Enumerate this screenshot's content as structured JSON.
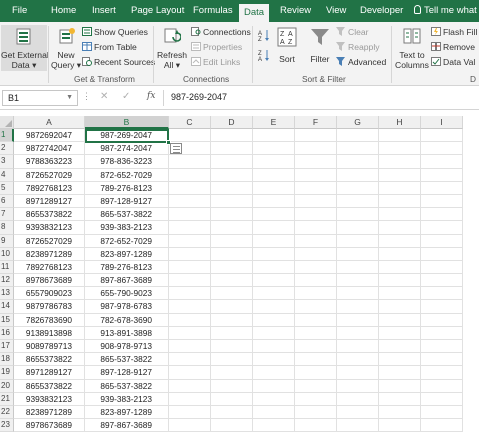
{
  "tabs": {
    "file": "File",
    "home": "Home",
    "insert": "Insert",
    "page_layout": "Page Layout",
    "formulas": "Formulas",
    "data": "Data",
    "review": "Review",
    "view": "View",
    "developer": "Developer",
    "tell_me": "Tell me what"
  },
  "ribbon": {
    "get_external_data": [
      "Get External",
      "Data"
    ],
    "new_query": [
      "New",
      "Query"
    ],
    "show_queries": "Show Queries",
    "from_table": "From Table",
    "recent_sources": "Recent Sources",
    "refresh_all": [
      "Refresh",
      "All"
    ],
    "connections": "Connections",
    "properties": "Properties",
    "edit_links": "Edit Links",
    "sort": "Sort",
    "filter": "Filter",
    "clear": "Clear",
    "reapply": "Reapply",
    "advanced": "Advanced",
    "text_to_columns": [
      "Text to",
      "Columns"
    ],
    "flash_fill": "Flash Fill",
    "remove_duplicates": "Remove",
    "data_validation": "Data Val",
    "groups": {
      "get_transform": "Get & Transform",
      "connections": "Connections",
      "sort_filter": "Sort & Filter",
      "data_tools_partial": "D"
    },
    "accent_color": "#217346"
  },
  "formula_bar": {
    "name_box": "B1",
    "fx": "fx",
    "value": "987-269-2047"
  },
  "grid": {
    "columns": [
      "A",
      "B",
      "C",
      "D",
      "E",
      "F",
      "G",
      "H",
      "I"
    ],
    "selected_cell": "B1",
    "rows": [
      [
        "1",
        "9872692047",
        "987-269-2047"
      ],
      [
        "2",
        "9872742047",
        "987-274-2047"
      ],
      [
        "3",
        "9788363223",
        "978-836-3223"
      ],
      [
        "4",
        "8726527029",
        "872-652-7029"
      ],
      [
        "5",
        "7892768123",
        "789-276-8123"
      ],
      [
        "6",
        "8971289127",
        "897-128-9127"
      ],
      [
        "7",
        "8655373822",
        "865-537-3822"
      ],
      [
        "8",
        "9393832123",
        "939-383-2123"
      ],
      [
        "9",
        "8726527029",
        "872-652-7029"
      ],
      [
        "10",
        "8238971289",
        "823-897-1289"
      ],
      [
        "11",
        "7892768123",
        "789-276-8123"
      ],
      [
        "12",
        "8978673689",
        "897-867-3689"
      ],
      [
        "13",
        "6557909023",
        "655-790-9023"
      ],
      [
        "14",
        "9879786783",
        "987-978-6783"
      ],
      [
        "15",
        "7826783690",
        "782-678-3690"
      ],
      [
        "16",
        "9138913898",
        "913-891-3898"
      ],
      [
        "17",
        "9089789713",
        "908-978-9713"
      ],
      [
        "18",
        "8655373822",
        "865-537-3822"
      ],
      [
        "19",
        "8971289127",
        "897-128-9127"
      ],
      [
        "20",
        "8655373822",
        "865-537-3822"
      ],
      [
        "21",
        "9393832123",
        "939-383-2123"
      ],
      [
        "22",
        "8238971289",
        "823-897-1289"
      ],
      [
        "23",
        "8978673689",
        "897-867-3689"
      ]
    ]
  }
}
